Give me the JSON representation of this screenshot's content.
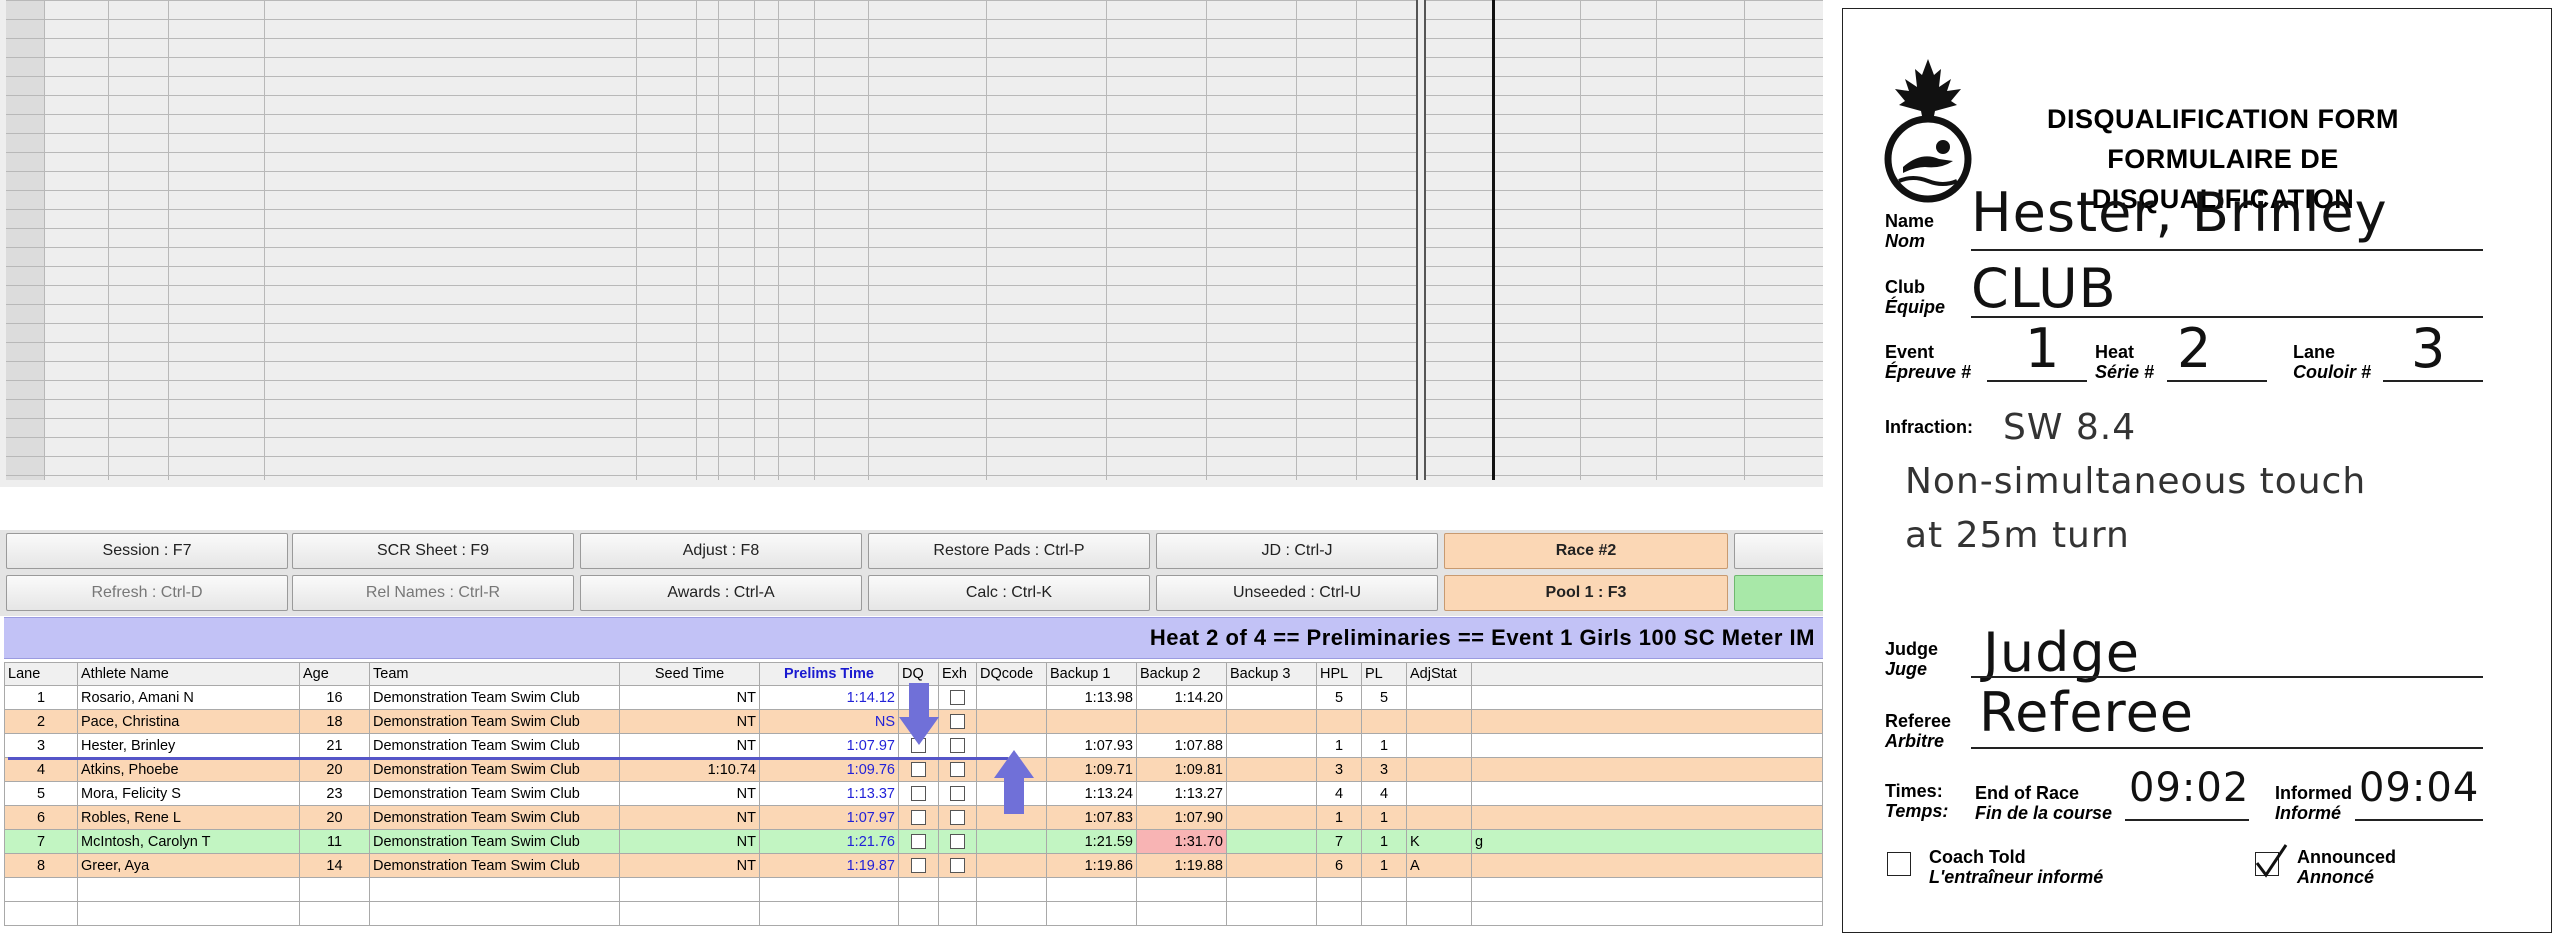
{
  "function_buttons": {
    "row1": [
      "Session : F7",
      "SCR Sheet : F9",
      "Adjust : F8",
      "Restore Pads : Ctrl-P",
      "JD : Ctrl-J",
      "Race #2"
    ],
    "row2": [
      "Refresh : Ctrl-D",
      "Rel Names : Ctrl-R",
      "Awards : Ctrl-A",
      "Calc : Ctrl-K",
      "Unseeded : Ctrl-U",
      "Pool 1 : F3"
    ]
  },
  "heat_banner": "Heat  2  of  4  ==  Preliminaries  ==  Event 1  Girls 100 SC Meter IM",
  "results_table": {
    "headers": [
      "Lane",
      "Athlete Name",
      "Age",
      "Team",
      "Seed Time",
      "Prelims Time",
      "DQ",
      "Exh",
      "DQcode",
      "Backup 1",
      "Backup 2",
      "Backup 3",
      "HPL",
      "PL",
      "AdjStat"
    ],
    "rows": [
      {
        "lane": "1",
        "name": "Rosario, Amani N",
        "age": "16",
        "team": "Demonstration Team Swim Club",
        "seed": "NT",
        "prelims": "1:14.12",
        "b1": "1:13.98",
        "b2": "1:14.20",
        "b3": "",
        "hpl": "5",
        "pl": "5",
        "adj": "",
        "extra": ""
      },
      {
        "lane": "2",
        "name": "Pace, Christina",
        "age": "18",
        "team": "Demonstration Team Swim Club",
        "seed": "NT",
        "prelims": "NS",
        "b1": "",
        "b2": "",
        "b3": "",
        "hpl": "",
        "pl": "",
        "adj": "",
        "extra": ""
      },
      {
        "lane": "3",
        "name": "Hester, Brinley",
        "age": "21",
        "team": "Demonstration Team Swim Club",
        "seed": "NT",
        "prelims": "1:07.97",
        "b1": "1:07.93",
        "b2": "1:07.88",
        "b3": "",
        "hpl": "1",
        "pl": "1",
        "adj": "",
        "extra": ""
      },
      {
        "lane": "4",
        "name": "Atkins, Phoebe",
        "age": "20",
        "team": "Demonstration Team Swim Club",
        "seed": "1:10.74",
        "prelims": "1:09.76",
        "b1": "1:09.71",
        "b2": "1:09.81",
        "b3": "",
        "hpl": "3",
        "pl": "3",
        "adj": "",
        "extra": ""
      },
      {
        "lane": "5",
        "name": "Mora, Felicity S",
        "age": "23",
        "team": "Demonstration Team Swim Club",
        "seed": "NT",
        "prelims": "1:13.37",
        "b1": "1:13.24",
        "b2": "1:13.27",
        "b3": "",
        "hpl": "4",
        "pl": "4",
        "adj": "",
        "extra": ""
      },
      {
        "lane": "6",
        "name": "Robles, Rene L",
        "age": "20",
        "team": "Demonstration Team Swim Club",
        "seed": "NT",
        "prelims": "1:07.97",
        "b1": "1:07.83",
        "b2": "1:07.90",
        "b3": "",
        "hpl": "1",
        "pl": "1",
        "adj": "",
        "extra": ""
      },
      {
        "lane": "7",
        "name": "McIntosh, Carolyn T",
        "age": "11",
        "team": "Demonstration Team Swim Club",
        "seed": "NT",
        "prelims": "1:21.76",
        "b1": "1:21.59",
        "b2": "1:31.70",
        "b3": "",
        "hpl": "7",
        "pl": "1",
        "adj": "K",
        "extra": "g"
      },
      {
        "lane": "8",
        "name": "Greer, Aya",
        "age": "14",
        "team": "Demonstration Team Swim Club",
        "seed": "NT",
        "prelims": "1:19.87",
        "b1": "1:19.86",
        "b2": "1:19.88",
        "b3": "",
        "hpl": "6",
        "pl": "1",
        "adj": "A",
        "extra": ""
      }
    ]
  },
  "dq_form": {
    "title_en": "DISQUALIFICATION FORM",
    "title_fr": "FORMULAIRE DE DISQUALIFICATION",
    "name_label": "Name",
    "name_label_fr": "Nom",
    "name_value": "Hester, Brinley",
    "club_label": "Club",
    "club_label_fr": "Équipe",
    "club_value": "CLUB",
    "event_label": "Event",
    "event_label_fr": "Épreuve #",
    "event_value": "1",
    "heat_label": "Heat",
    "heat_label_fr": "Série #",
    "heat_value": "2",
    "lane_label": "Lane",
    "lane_label_fr": "Couloir #",
    "lane_value": "3",
    "infraction_label": "Infraction:",
    "infraction_code": "SW 8.4",
    "infraction_line1": "Non-simultaneous touch",
    "infraction_line2": "at 25m turn",
    "judge_label": "Judge",
    "judge_label_fr": "Juge",
    "judge_value": "Judge",
    "referee_label": "Referee",
    "referee_label_fr": "Arbitre",
    "referee_value": "Referee",
    "times_label": "Times:",
    "times_label_fr": "Temps:",
    "end_label": "End of Race",
    "end_label_fr": "Fin de la course",
    "end_value": "09:02",
    "informed_label": "Informed",
    "informed_label_fr": "Informé",
    "informed_value": "09:04",
    "coach_label": "Coach Told",
    "coach_label_fr": "L'entraîneur informé",
    "coach_checked": false,
    "announced_label": "Announced",
    "announced_label_fr": "Annoncé",
    "announced_checked": true
  }
}
